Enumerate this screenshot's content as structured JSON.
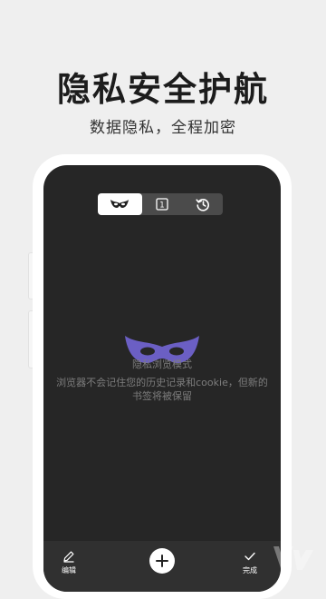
{
  "headline": "隐私安全护航",
  "subheadline": "数据隐私，全程加密",
  "tabs": [
    {
      "icon": "mask-icon",
      "active": true
    },
    {
      "icon": "tab-count-icon",
      "count": "1",
      "active": false
    },
    {
      "icon": "history-icon",
      "active": false
    }
  ],
  "empty_state": {
    "title": "隐私浏览模式",
    "description": "浏览器不会记住您的历史记录和cookie，但新的书签将被保留"
  },
  "bottom_bar": {
    "edit_label": "编辑",
    "done_label": "完成"
  },
  "colors": {
    "mask_accent": "#6b5fc4",
    "screen_bg": "#262626",
    "bar_bg": "#303030"
  }
}
